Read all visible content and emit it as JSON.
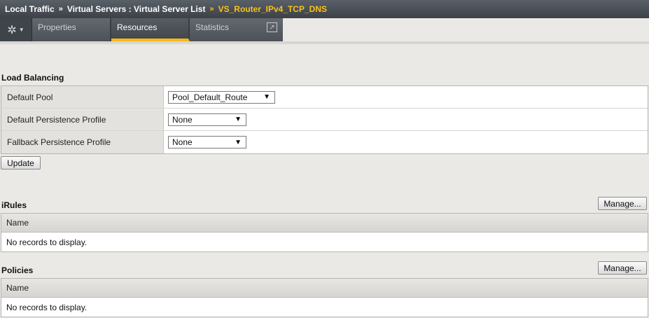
{
  "breadcrumb": {
    "items": [
      "Local Traffic",
      "Virtual Servers : Virtual Server List",
      "VS_Router_IPv4_TCP_DNS"
    ],
    "separator": "»"
  },
  "tabs": {
    "settings_icon": "gear-icon",
    "items": [
      {
        "label": "Properties",
        "active": false
      },
      {
        "label": "Resources",
        "active": true
      },
      {
        "label": "Statistics",
        "active": false
      }
    ],
    "popout_icon": "external-link-icon"
  },
  "load_balancing": {
    "title": "Load Balancing",
    "rows": [
      {
        "label": "Default Pool",
        "value": "Pool_Default_Route"
      },
      {
        "label": "Default Persistence Profile",
        "value": "None"
      },
      {
        "label": "Fallback Persistence Profile",
        "value": "None"
      }
    ],
    "update_label": "Update"
  },
  "irules": {
    "title": "iRules",
    "manage_label": "Manage...",
    "column": "Name",
    "empty_text": "No records to display."
  },
  "policies": {
    "title": "Policies",
    "manage_label": "Manage...",
    "column": "Name",
    "empty_text": "No records to display."
  },
  "colors": {
    "accent": "#f4b81a",
    "current_crumb": "#f8c21c",
    "header_bg": "#3c4148"
  }
}
